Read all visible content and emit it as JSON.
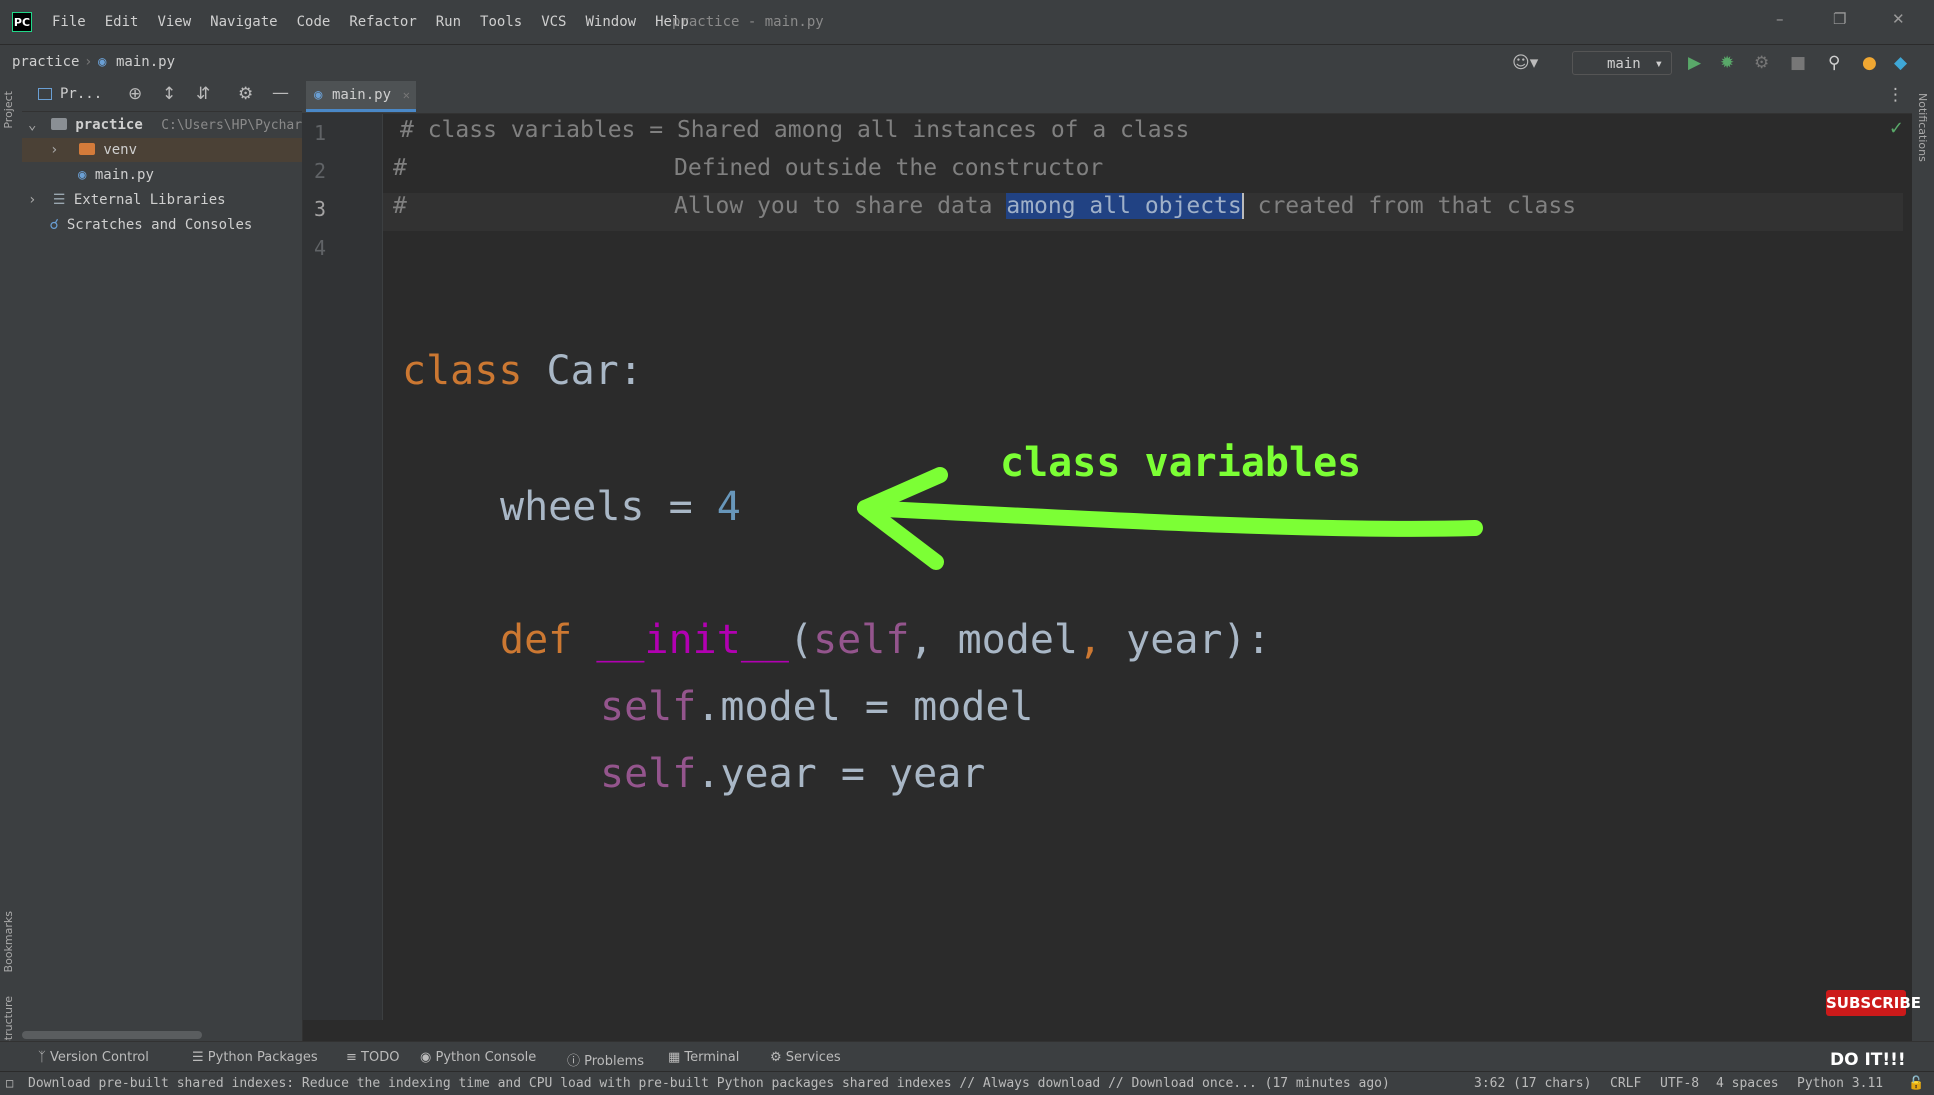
{
  "app": {
    "logo": "PC",
    "window_title": "practice - main.py",
    "menu": [
      "File",
      "Edit",
      "View",
      "Navigate",
      "Code",
      "Refactor",
      "Run",
      "Tools",
      "VCS",
      "Window",
      "Help"
    ]
  },
  "navbar": {
    "breadcrumb": [
      "practice",
      "main.py"
    ],
    "run_config": "main"
  },
  "project_panel": {
    "title": "Pr...",
    "tree": [
      {
        "label": "practice",
        "path": "C:\\Users\\HP\\Pychar"
      },
      {
        "label": "venv"
      },
      {
        "label": "main.py"
      },
      {
        "label": "External Libraries"
      },
      {
        "label": "Scratches and Consoles"
      }
    ]
  },
  "side_labels": {
    "left_top": "Project",
    "left_bottom1": "Bookmarks",
    "left_bottom2": "Structure",
    "right": "Notifications"
  },
  "editor": {
    "tab": "main.py",
    "line_numbers": [
      "1",
      "2",
      "3",
      "4"
    ],
    "comment_line1": "# class variables = Shared among all instances of a class",
    "comment_line2_hash": "#",
    "comment_line2_text": "Defined outside the constructor",
    "comment_line3_hash": "#",
    "comment_line3_pre": "Allow you to share data ",
    "comment_line3_selected": "among all objects",
    "comment_line3_post": " created from that class",
    "code": {
      "class_kw": "class",
      "class_name": " Car:",
      "wheels_name": "wheels = ",
      "wheels_value": "4",
      "def_kw": "def",
      "init_name": "__init__",
      "params_open": "(",
      "params_self": "self",
      "params_rest_a": ", model",
      "params_comma": ",",
      "params_rest_b": " year):",
      "self1": "self",
      "assign1": ".model = model",
      "self2": "self",
      "assign2": ".year = year"
    },
    "annotation": "class variables"
  },
  "toolwindows": [
    "Version Control",
    "Python Packages",
    "TODO",
    "Python Console",
    "Problems",
    "Terminal",
    "Services"
  ],
  "statusbar": {
    "message": "Download pre-built shared indexes: Reduce the indexing time and CPU load with pre-built Python packages shared indexes // Always download // Download once... (17 minutes ago)",
    "position": "3:62 (17 chars)",
    "line_sep": "CRLF",
    "encoding": "UTF-8",
    "indent": "4 spaces",
    "interpreter": "Python 3.11"
  },
  "overlay": {
    "subscribe": "SUBSCRIBE",
    "doit": "DO IT!!!"
  }
}
